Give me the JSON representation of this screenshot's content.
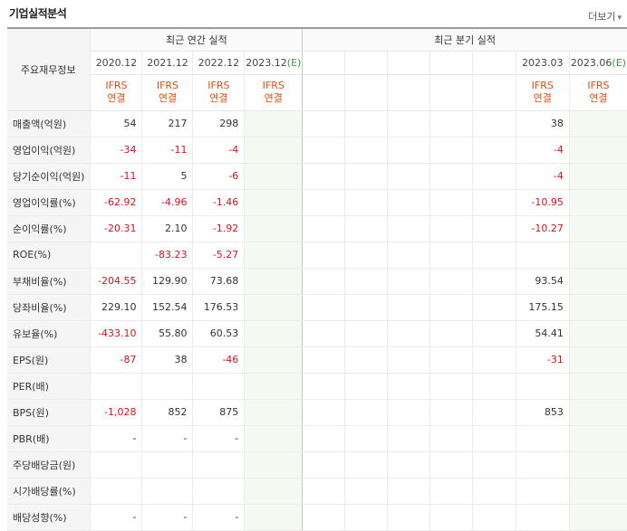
{
  "header": {
    "title": "기업실적분석",
    "more_label": "더보기",
    "more_arrow": "▾"
  },
  "table": {
    "corner_label": "주요재무정보",
    "annual_group": "최근 연간 실적",
    "quarter_group": "최근 분기 실적",
    "annual_periods": [
      "2020.12",
      "2021.12",
      "2022.12",
      "2023.12(E)"
    ],
    "quarter_periods": [
      "",
      "",
      "",
      "",
      "",
      "2023.03",
      "2023.06(E)"
    ],
    "ifrs_label": "IFRS",
    "consol_label": "연결",
    "rows": [
      {
        "label": "매출액(억원)",
        "annual": [
          "54",
          "217",
          "298",
          ""
        ],
        "quarter": [
          "",
          "",
          "",
          "",
          "",
          "38",
          ""
        ]
      },
      {
        "label": "영업이익(억원)",
        "annual": [
          "-34",
          "-11",
          "-4",
          ""
        ],
        "quarter": [
          "",
          "",
          "",
          "",
          "",
          "-4",
          ""
        ]
      },
      {
        "label": "당기순이익(억원)",
        "annual": [
          "-11",
          "5",
          "-6",
          ""
        ],
        "quarter": [
          "",
          "",
          "",
          "",
          "",
          "-4",
          ""
        ]
      },
      {
        "label": "영업이익률(%)",
        "annual": [
          "-62.92",
          "-4.96",
          "-1.46",
          ""
        ],
        "quarter": [
          "",
          "",
          "",
          "",
          "",
          "-10.95",
          ""
        ]
      },
      {
        "label": "순이익률(%)",
        "annual": [
          "-20.31",
          "2.10",
          "-1.92",
          ""
        ],
        "quarter": [
          "",
          "",
          "",
          "",
          "",
          "-10.27",
          ""
        ]
      },
      {
        "label": "ROE(%)",
        "annual": [
          "",
          "-83.23",
          "-5.27",
          ""
        ],
        "quarter": [
          "",
          "",
          "",
          "",
          "",
          "",
          ""
        ]
      },
      {
        "label": "부채비율(%)",
        "annual": [
          "-204.55",
          "129.90",
          "73.68",
          ""
        ],
        "quarter": [
          "",
          "",
          "",
          "",
          "",
          "93.54",
          ""
        ]
      },
      {
        "label": "당좌비율(%)",
        "annual": [
          "229.10",
          "152.54",
          "176.53",
          ""
        ],
        "quarter": [
          "",
          "",
          "",
          "",
          "",
          "175.15",
          ""
        ]
      },
      {
        "label": "유보율(%)",
        "annual": [
          "-433.10",
          "55.80",
          "60.53",
          ""
        ],
        "quarter": [
          "",
          "",
          "",
          "",
          "",
          "54.41",
          ""
        ]
      },
      {
        "label": "EPS(원)",
        "annual": [
          "-87",
          "38",
          "-46",
          ""
        ],
        "quarter": [
          "",
          "",
          "",
          "",
          "",
          "-31",
          ""
        ]
      },
      {
        "label": "PER(배)",
        "annual": [
          "",
          "",
          "",
          ""
        ],
        "quarter": [
          "",
          "",
          "",
          "",
          "",
          "",
          ""
        ]
      },
      {
        "label": "BPS(원)",
        "annual": [
          "-1,028",
          "852",
          "875",
          ""
        ],
        "quarter": [
          "",
          "",
          "",
          "",
          "",
          "853",
          ""
        ]
      },
      {
        "label": "PBR(배)",
        "annual": [
          "-",
          "-",
          "-",
          ""
        ],
        "quarter": [
          "",
          "",
          "",
          "",
          "",
          "",
          ""
        ]
      },
      {
        "label": "주당배당금(원)",
        "annual": [
          "",
          "",
          "",
          ""
        ],
        "quarter": [
          "",
          "",
          "",
          "",
          "",
          "",
          ""
        ]
      },
      {
        "label": "시가배당률(%)",
        "annual": [
          "",
          "",
          "",
          ""
        ],
        "quarter": [
          "",
          "",
          "",
          "",
          "",
          "",
          ""
        ]
      },
      {
        "label": "배당성향(%)",
        "annual": [
          "-",
          "-",
          "-",
          ""
        ],
        "quarter": [
          "",
          "",
          "",
          "",
          "",
          "",
          ""
        ]
      }
    ]
  }
}
